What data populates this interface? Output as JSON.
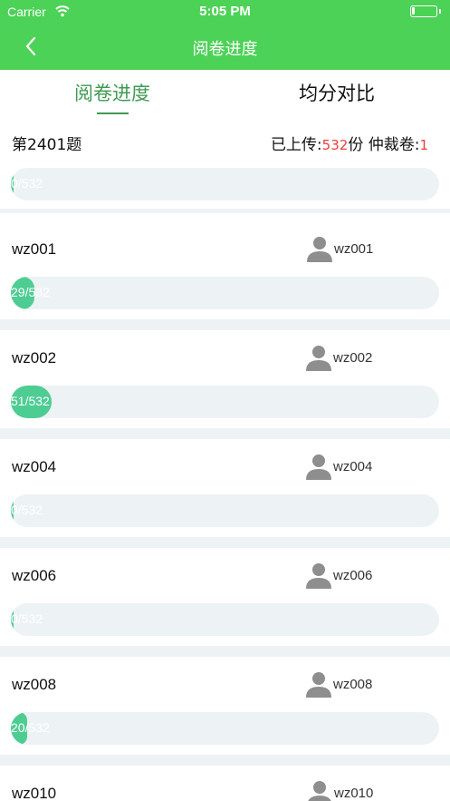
{
  "status_bar": {
    "carrier": "Carrier",
    "time": "5:05 PM"
  },
  "nav": {
    "title": "阅卷进度",
    "back_icon": "chevron-left-icon"
  },
  "tabs": [
    {
      "label": "阅卷进度",
      "active": true
    },
    {
      "label": "均分对比",
      "active": false
    }
  ],
  "summary": {
    "question": "第2401题",
    "uploaded_label": "已上传:",
    "uploaded_count": "532",
    "uploaded_unit": "份",
    "arbitration_label": " 仲裁卷:",
    "arbitration_count": "1",
    "progress": {
      "text": "0/532",
      "fraction": 0.0
    }
  },
  "colors": {
    "accent": "#4cd256",
    "progress_fill": "#4ecd93",
    "progress_track": "#edf3f4",
    "highlight": "#ef3b3b",
    "tab_active": "#3f9a52"
  },
  "graders": [
    {
      "name": "wz001",
      "user": "wz001",
      "progress_text": "29/532",
      "progress_fraction": 0.0545
    },
    {
      "name": "wz002",
      "user": "wz002",
      "progress_text": "51/532",
      "progress_fraction": 0.0959
    },
    {
      "name": "wz004",
      "user": "wz004",
      "progress_text": "0/532",
      "progress_fraction": 0.0
    },
    {
      "name": "wz006",
      "user": "wz006",
      "progress_text": "0/532",
      "progress_fraction": 0.0
    },
    {
      "name": "wz008",
      "user": "wz008",
      "progress_text": "20/532",
      "progress_fraction": 0.0376
    },
    {
      "name": "wz010",
      "user": "wz010",
      "progress_text": "",
      "progress_fraction": null
    }
  ]
}
